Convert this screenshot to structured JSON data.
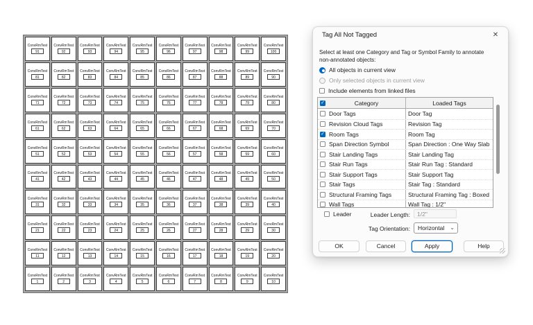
{
  "room_grid": {
    "cell_label": "ConvRmTest",
    "rows": [
      [
        91,
        92,
        93,
        94,
        95,
        96,
        97,
        98,
        99,
        100
      ],
      [
        81,
        82,
        83,
        84,
        85,
        86,
        87,
        88,
        89,
        90
      ],
      [
        71,
        72,
        73,
        74,
        75,
        76,
        77,
        78,
        79,
        80
      ],
      [
        61,
        62,
        63,
        64,
        65,
        66,
        67,
        68,
        69,
        70
      ],
      [
        51,
        52,
        53,
        54,
        55,
        56,
        57,
        58,
        59,
        60
      ],
      [
        41,
        42,
        43,
        44,
        45,
        46,
        47,
        48,
        49,
        50
      ],
      [
        31,
        32,
        33,
        34,
        35,
        36,
        37,
        38,
        39,
        40
      ],
      [
        21,
        22,
        23,
        24,
        25,
        26,
        27,
        28,
        29,
        30
      ],
      [
        11,
        12,
        13,
        14,
        15,
        16,
        17,
        18,
        19,
        20
      ],
      [
        1,
        2,
        3,
        4,
        5,
        6,
        7,
        8,
        9,
        10
      ]
    ]
  },
  "dialog": {
    "title": "Tag All Not Tagged",
    "icons": {
      "close": "✕",
      "check": "✓",
      "chevron_down": "⌄"
    },
    "intro": "Select at least one Category and Tag or Symbol Family to annotate non-annotated objects:",
    "radios": [
      {
        "label": "All objects in current view",
        "selected": true,
        "enabled": true
      },
      {
        "label": "Only selected objects in current view",
        "selected": false,
        "enabled": false
      }
    ],
    "include_linked": {
      "label": "Include elements from linked files",
      "checked": false
    },
    "table": {
      "columns": [
        "Category",
        "Loaded Tags"
      ],
      "header_checkbox_checked": true,
      "rows": [
        {
          "checked": false,
          "category": "Door Tags",
          "loaded": "Door Tag"
        },
        {
          "checked": false,
          "category": "Revision Cloud Tags",
          "loaded": "Revision Tag"
        },
        {
          "checked": true,
          "category": "Room Tags",
          "loaded": "Room Tag"
        },
        {
          "checked": false,
          "category": "Span Direction Symbol",
          "loaded": "Span Direction : One Way Slab"
        },
        {
          "checked": false,
          "category": "Stair Landing Tags",
          "loaded": "Stair Landing Tag"
        },
        {
          "checked": false,
          "category": "Stair Run Tags",
          "loaded": "Stair Run Tag : Standard"
        },
        {
          "checked": false,
          "category": "Stair Support Tags",
          "loaded": "Stair Support Tag"
        },
        {
          "checked": false,
          "category": "Stair Tags",
          "loaded": "Stair Tag : Standard"
        },
        {
          "checked": false,
          "category": "Structural Framing Tags",
          "loaded": "Structural Framing Tag : Boxed"
        },
        {
          "checked": false,
          "category": "Wall Tags",
          "loaded": "Wall Tag : 1/2\""
        }
      ]
    },
    "leader": {
      "label": "Leader",
      "checked": false,
      "length_label": "Leader Length:",
      "length_value": "1/2\""
    },
    "orientation": {
      "label": "Tag Orientation:",
      "value": "Horizontal"
    },
    "buttons": {
      "ok": "OK",
      "cancel": "Cancel",
      "apply": "Apply",
      "help": "Help"
    },
    "colors": {
      "accent": "#0067c0"
    }
  }
}
